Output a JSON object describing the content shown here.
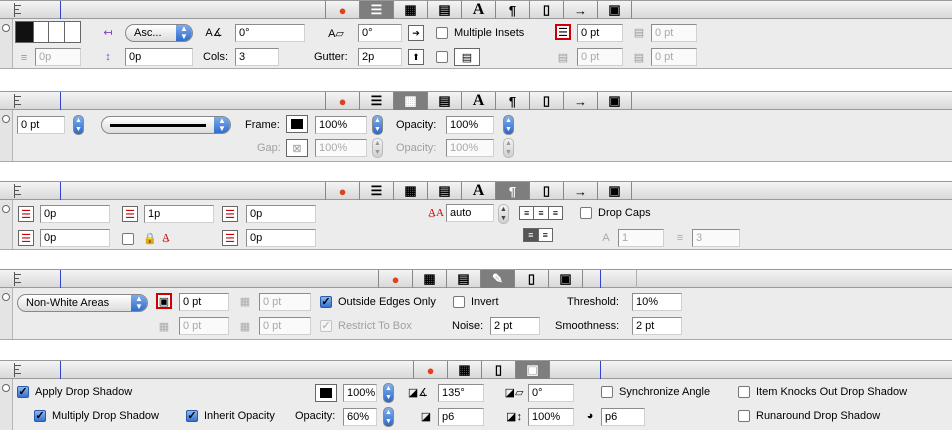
{
  "colors": {
    "accent": "#2d68c8",
    "tab_active": "#7e7e7e",
    "ruler_blue": "#3344cc",
    "panel": "#ececec"
  },
  "tab_icons": {
    "swatch": "🔴",
    "align": "☰",
    "frame": "▦",
    "text_frame": "▤",
    "character": "A",
    "paragraph": "¶",
    "shapes": "▯",
    "arrow": "→",
    "shadow": "▣",
    "pen": "✎"
  },
  "text_frame": {
    "vertical_align": "Asc...",
    "angle": "0°",
    "skew": "0°",
    "gap": "0p",
    "cols_label": "Cols:",
    "cols": "3",
    "gutter_label": "Gutter:",
    "gutter": "2p",
    "multiple_insets_label": "Multiple Insets",
    "inset_top": "0 pt",
    "inset_left": "0 pt",
    "inset_right": "0 pt",
    "inset_bottom": "0 pt",
    "baseline": "0p"
  },
  "frame": {
    "width": "0 pt",
    "frame_label": "Frame:",
    "frame_shade": "100%",
    "opacity_label": "Opacity:",
    "opacity": "100%",
    "gap_label": "Gap:",
    "gap_shade": "100%",
    "gap_opacity_label": "Opacity:",
    "gap_opacity": "100%"
  },
  "paragraph": {
    "left_indent": "0p",
    "first_indent": "1p",
    "space_before": "0p",
    "right_indent": "0p",
    "space_after": "0p",
    "leading": "auto",
    "drop_caps_label": "Drop Caps",
    "drop_chars": "1",
    "drop_lines": "3"
  },
  "runaround": {
    "type": "Non-White Areas",
    "outset": "0 pt",
    "outset_2": "0 pt",
    "outset_3": "0 pt",
    "outset_4": "0 pt",
    "outside_edges_label": "Outside Edges Only",
    "invert_label": "Invert",
    "restrict_label": "Restrict To Box",
    "threshold_label": "Threshold:",
    "threshold": "10%",
    "noise_label": "Noise:",
    "noise": "2 pt",
    "smoothness_label": "Smoothness:",
    "smoothness": "2 pt"
  },
  "shadow": {
    "apply_label": "Apply Drop Shadow",
    "multiply_label": "Multiply Drop Shadow",
    "inherit_label": "Inherit Opacity",
    "shade": "100%",
    "opacity_label": "Opacity:",
    "opacity": "60%",
    "angle": "135°",
    "skew": "0°",
    "distance": "p6",
    "scale": "100%",
    "blur": "p6",
    "sync_label": "Synchronize Angle",
    "knocks_label": "Item Knocks Out Drop Shadow",
    "runaround_label": "Runaround Drop Shadow"
  }
}
